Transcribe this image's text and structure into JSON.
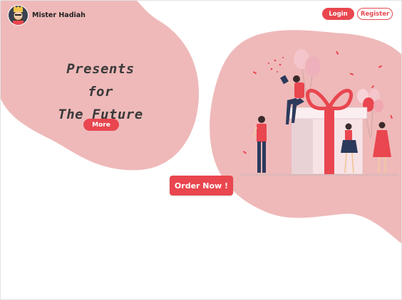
{
  "header": {
    "brand": "Mister Hadiah",
    "login_label": "Login",
    "register_label": "Register"
  },
  "hero": {
    "title_line1": "Presents for",
    "title_line2": "The Future",
    "more_label": "More",
    "order_label": "Order Now !"
  },
  "colors": {
    "accent": "#e9464f",
    "blob": "#efb9b9",
    "text": "#3a3a3a"
  },
  "icons": {
    "avatar": "mascot-avatar",
    "illustration": "gift-party-illustration"
  }
}
